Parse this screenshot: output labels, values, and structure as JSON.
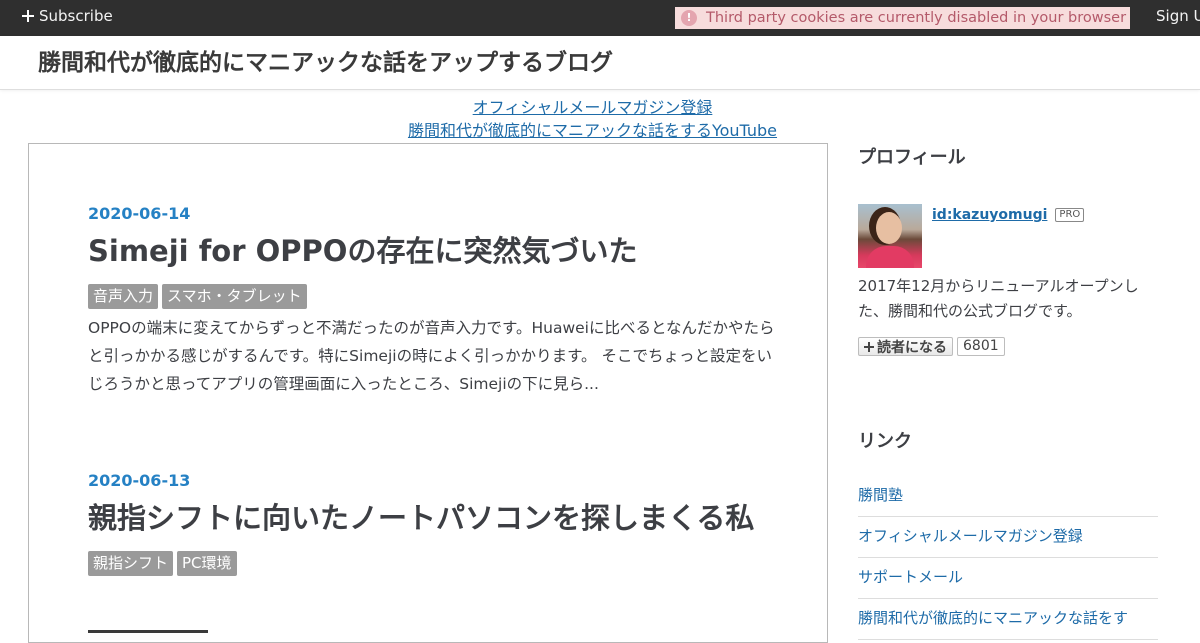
{
  "topbar": {
    "subscribe_label": "Subscribe",
    "cookie_notice": "Third party cookies are currently disabled in your browser",
    "signup_label": "Sign Up"
  },
  "header": {
    "blog_title": "勝間和代が徹底的にマニアックな話をアップするブログ",
    "links": [
      "オフィシャルメールマガジン登録",
      "勝間和代が徹底的にマニアックな話をするYouTube"
    ]
  },
  "entries": [
    {
      "date": "2020-06-14",
      "title": "Simeji for OPPOの存在に突然気づいた",
      "categories": [
        "音声入力",
        "スマホ・タブレット"
      ],
      "summary": "OPPOの端末に変えてからずっと不満だったのが音声入力です。Huaweiに比べるとなんだかやたらと引っかかる感じがするんです。特にSimejiの時によく引っかかります。 そこでちょっと設定をいじろうかと思ってアプリの管理画面に入ったところ、Simejiの下に見ら..."
    },
    {
      "date": "2020-06-13",
      "title": "親指シフトに向いたノートパソコンを探しまくる私",
      "categories": [
        "親指シフト",
        "PC環境"
      ]
    }
  ],
  "sidebar": {
    "profile_heading": "プロフィール",
    "profile_id": "id:kazuyomugi",
    "pro_badge": "PRO",
    "profile_description": "2017年12月からリニューアルオープンした、勝間和代の公式ブログです。",
    "follow_label": "読者になる",
    "follower_count": "6801",
    "links_heading": "リンク",
    "links": [
      "勝間塾",
      "オフィシャルメールマガジン登録",
      "サポートメール",
      "勝間和代が徹底的にマニアックな話をす"
    ]
  },
  "colors": {
    "topbar_bg": "#2f2f2f",
    "link": "#1e6ba8",
    "date": "#2581c4",
    "category_bg": "#9a9a9a",
    "cookie_notice_bg": "#f7dcdc",
    "cookie_notice_text": "#b45a6a"
  },
  "icons": [
    "plus-icon",
    "warning-icon",
    "follow-plus-icon"
  ]
}
